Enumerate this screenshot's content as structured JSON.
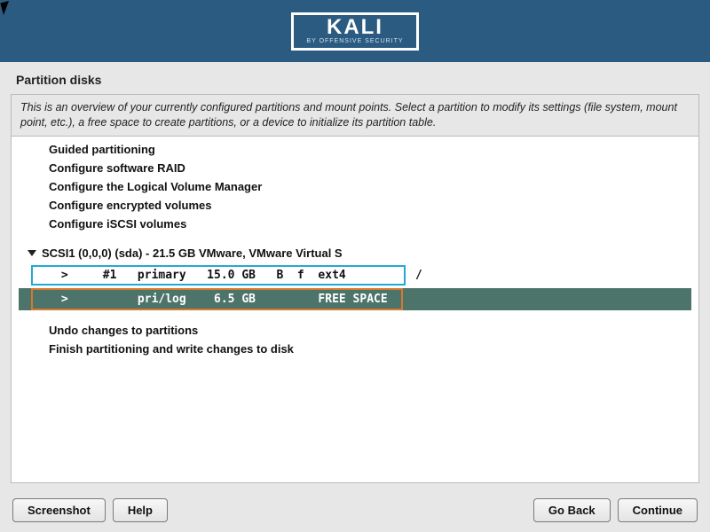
{
  "brand": {
    "name": "KALI",
    "byline": "BY OFFENSIVE SECURITY"
  },
  "title": "Partition disks",
  "intro": "This is an overview of your currently configured partitions and mount points. Select a partition to modify its settings (file system, mount point, etc.), a free space to create partitions, or a device to initialize its partition table.",
  "menu": {
    "items": [
      "Guided partitioning",
      "Configure software RAID",
      "Configure the Logical Volume Manager",
      "Configure encrypted volumes",
      "Configure iSCSI volumes"
    ]
  },
  "disk": {
    "label": "SCSI1 (0,0,0) (sda) - 21.5 GB VMware, VMware Virtual S",
    "partitions": [
      {
        "line": " >     #1   primary   15.0 GB   B  f  ext4          /",
        "highlighted": "blue"
      },
      {
        "line": " >          pri/log    6.5 GB         FREE SPACE",
        "highlighted": "orange",
        "selected": true
      }
    ]
  },
  "actions": {
    "items": [
      "Undo changes to partitions",
      "Finish partitioning and write changes to disk"
    ]
  },
  "buttons": {
    "screenshot": "Screenshot",
    "help": "Help",
    "goback": "Go Back",
    "continue": "Continue"
  }
}
